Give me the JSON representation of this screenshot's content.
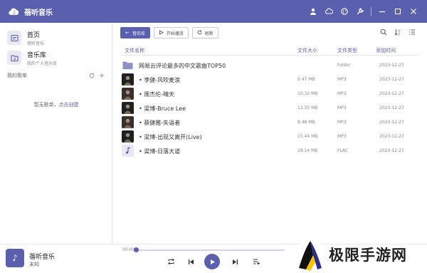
{
  "app": {
    "title": "蓓听音乐"
  },
  "sidebar": {
    "nav": [
      {
        "label": "首页",
        "sub": "蓓听音乐"
      },
      {
        "label": "音乐库",
        "sub": "我的个人音乐库"
      }
    ],
    "playlist_title": "我的歌单",
    "empty_text": "暂无歌单，",
    "create_link": "点击创建"
  },
  "toolbar": {
    "library_label": "音乐库",
    "play_label": "开始播放",
    "refresh_label": "刷新"
  },
  "table": {
    "columns": {
      "name": "文件名称",
      "size": "文件大小",
      "type": "文件类型",
      "date": "添加时间"
    },
    "rows": [
      {
        "name": "网易云评论最多的中文歌曲TOP50",
        "size": "",
        "type": "Folder",
        "date": "2023-12-27",
        "cover": "folder"
      },
      {
        "name": "• 李健-风吹麦浪",
        "size": "9.47 MB",
        "type": "MP3",
        "date": "2023-12-27",
        "cover": "dark"
      },
      {
        "name": "• 周杰伦-晴天",
        "size": "10.32 MB",
        "type": "MP3",
        "date": "2023-12-27",
        "cover": "dark2"
      },
      {
        "name": "• 梁博-Bruce Lee",
        "size": "12.35 MB",
        "type": "MP3",
        "date": "2023-12-27",
        "cover": "dark"
      },
      {
        "name": "• 蔡健雅-失语者",
        "size": "8.48 MB",
        "type": "MP3",
        "date": "2023-12-27",
        "cover": "dark2"
      },
      {
        "name": "• 梁博-出现又离开(Live)",
        "size": "15.44 MB",
        "type": "MP3",
        "date": "2023-12-27",
        "cover": "dark"
      },
      {
        "name": "• 梁博-日落大道",
        "size": "28.14 MB",
        "type": "FLAC",
        "date": "2023-12-27",
        "cover": "light"
      }
    ]
  },
  "player": {
    "title": "蓓听音乐",
    "artist": "未知",
    "time": "00:00",
    "progress": 0
  },
  "watermark": {
    "text": "极限手游网"
  },
  "colors": {
    "accent": "#5a5fae"
  }
}
